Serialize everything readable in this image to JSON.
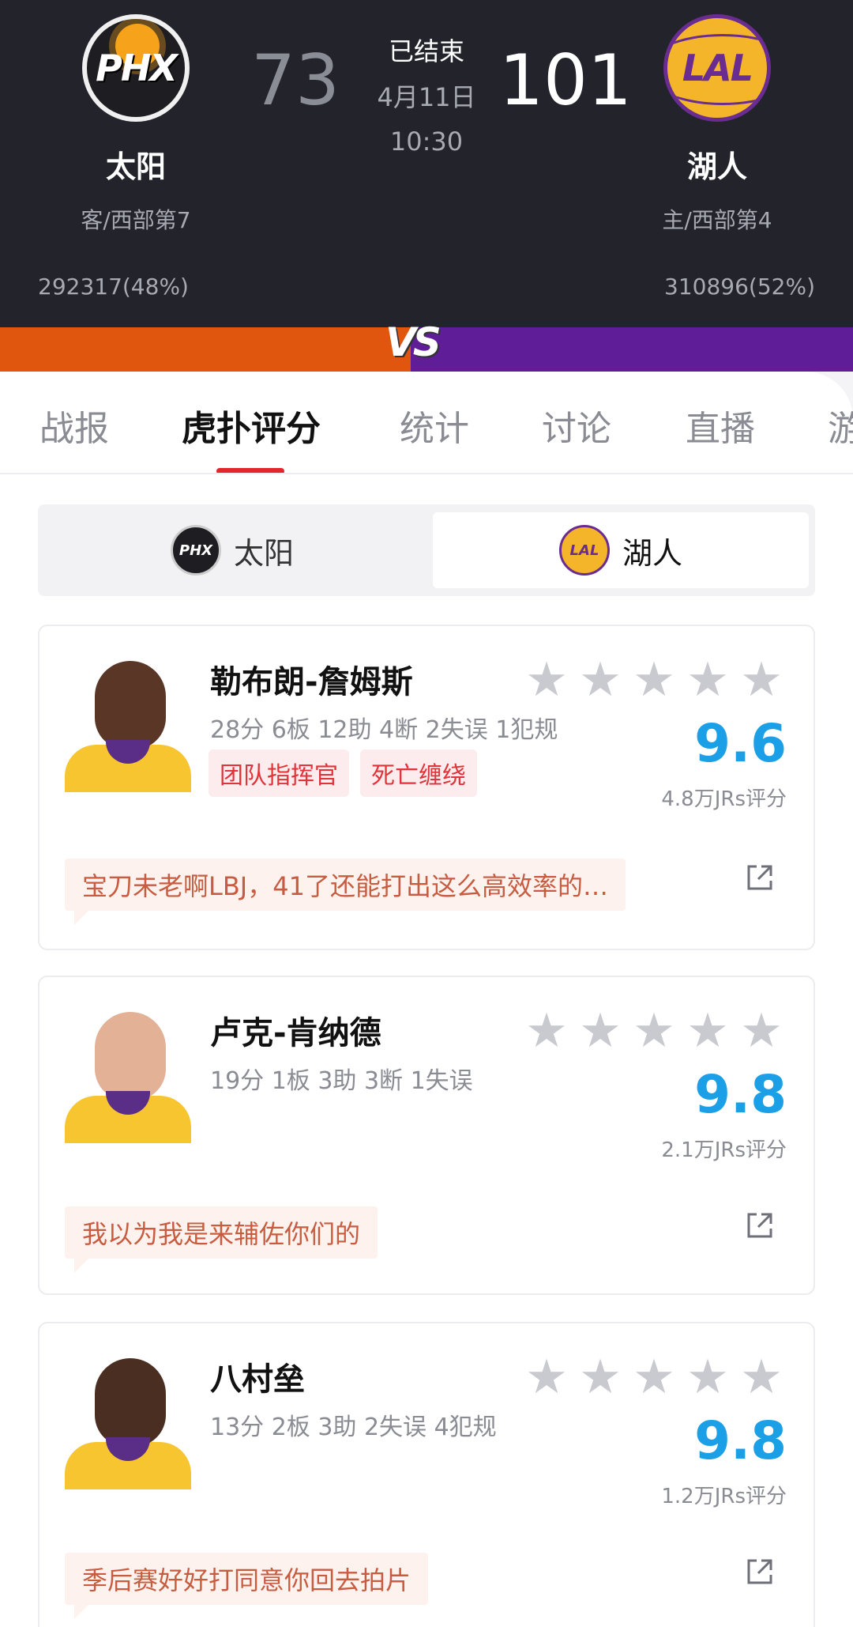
{
  "game": {
    "status": "已结束",
    "date": "4月11日",
    "time": "10:30",
    "vs_label": "VS"
  },
  "away": {
    "logo_text": "PHX",
    "name": "太阳",
    "rank": "客/西部第7",
    "score": "73",
    "votes": "292317(48%)",
    "color": "#e1560f"
  },
  "home": {
    "logo_text": "LAL",
    "name": "湖人",
    "rank": "主/西部第4",
    "score": "101",
    "votes": "310896(52%)",
    "color": "#5f1e97"
  },
  "tabs": [
    "战报",
    "虎扑评分",
    "统计",
    "讨论",
    "直播",
    "游"
  ],
  "active_tab": "虎扑评分",
  "team_switch": {
    "left": "太阳",
    "right": "湖人",
    "selected": "湖人"
  },
  "players": [
    {
      "name": "勒布朗-詹姆斯",
      "stats": "28分 6板 12助 4断 2失误 1犯规",
      "tags": [
        "团队指挥官",
        "死亡缠绕"
      ],
      "rating": "9.6",
      "votes": "4.8万JRs评分",
      "comment": "宝刀未老啊LBJ，41了还能打出这么高效率的…",
      "stars": 5
    },
    {
      "name": "卢克-肯纳德",
      "stats": "19分 1板 3助 3断 1失误",
      "tags": [],
      "rating": "9.8",
      "votes": "2.1万JRs评分",
      "comment": "我以为我是来辅佐你们的",
      "stars": 5
    },
    {
      "name": "八村垒",
      "stats": "13分 2板 3助 2失误 4犯规",
      "tags": [],
      "rating": "9.8",
      "votes": "1.2万JRs评分",
      "comment": "季后赛好好打同意你回去拍片",
      "stars": 5
    }
  ],
  "colors": {
    "rating_blue": "#1ba0e8",
    "tag_red": "#e0333a",
    "tab_underline": "#e4262a",
    "header_bg": "#22232b"
  }
}
